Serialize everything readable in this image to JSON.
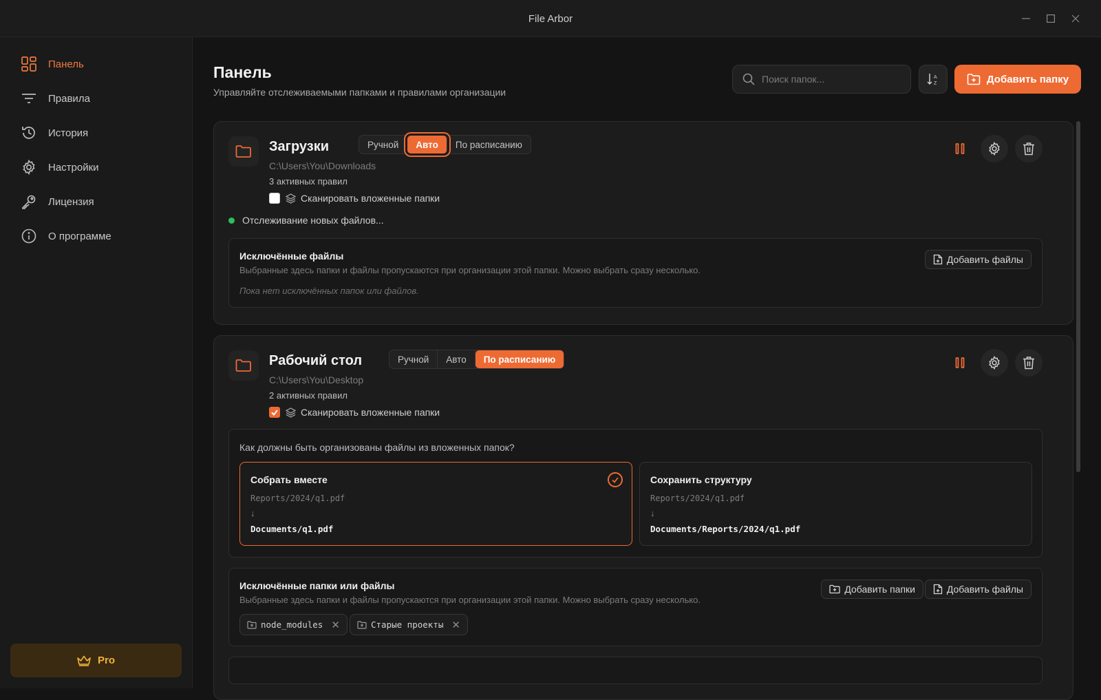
{
  "app": {
    "title": "File Arbor"
  },
  "window_controls": {
    "minimize_icon": "minimize-icon",
    "maximize_icon": "maximize-icon",
    "close_icon": "close-icon"
  },
  "sidebar": {
    "items": [
      {
        "label": "Панель",
        "icon": "dashboard-grid-icon",
        "active": true
      },
      {
        "label": "Правила",
        "icon": "filter-lines-icon",
        "active": false
      },
      {
        "label": "История",
        "icon": "history-icon",
        "active": false
      },
      {
        "label": "Настройки",
        "icon": "gear-icon",
        "active": false
      },
      {
        "label": "Лицензия",
        "icon": "key-icon",
        "active": false
      },
      {
        "label": "О программе",
        "icon": "info-icon",
        "active": false
      }
    ],
    "pro_label": "Pro"
  },
  "header": {
    "title": "Панель",
    "subtitle": "Управляйте отслеживаемыми папками и правилами организации",
    "search_placeholder": "Поиск папок...",
    "add_folder_label": "Добавить папку"
  },
  "colors": {
    "accent": "#ee6a33",
    "status_active": "#2dbd5b",
    "pro": "#f2b33a"
  },
  "folders": [
    {
      "name": "Загрузки",
      "path": "C:\\Users\\You\\Downloads",
      "rules": "3 активных правил",
      "modes": [
        "Ручной",
        "Авто",
        "По расписанию"
      ],
      "selected_mode": "Авто",
      "scan_label": "Сканировать вложенные папки",
      "scan_checked": false,
      "status": "Отслеживание новых файлов...",
      "excluded": {
        "title": "Исключённые файлы",
        "desc": "Выбранные здесь папки и файлы пропускаются при организации этой папки. Можно выбрать сразу несколько.",
        "empty": "Пока нет исключённых папок или файлов.",
        "add_files_label": "Добавить файлы"
      }
    },
    {
      "name": "Рабочий стол",
      "path": "C:\\Users\\You\\Desktop",
      "rules": "2 активных правил",
      "modes": [
        "Ручной",
        "Авто",
        "По расписанию"
      ],
      "selected_mode": "По расписанию",
      "scan_label": "Сканировать вложенные папки",
      "scan_checked": true,
      "organize": {
        "question": "Как должны быть организованы файлы из вложенных папок?",
        "options": [
          {
            "title": "Собрать вместе",
            "from": "Reports/2024/q1.pdf",
            "arrow": "↓",
            "to": "Documents/q1.pdf",
            "selected": true
          },
          {
            "title": "Сохранить структуру",
            "from": "Reports/2024/q1.pdf",
            "arrow": "↓",
            "to": "Documents/Reports/2024/q1.pdf",
            "selected": false
          }
        ]
      },
      "excluded": {
        "title": "Исключённые папки или файлы",
        "desc": "Выбранные здесь папки и файлы пропускаются при организации этой папки. Можно выбрать сразу несколько.",
        "add_folders_label": "Добавить папки",
        "add_files_label": "Добавить файлы",
        "chips": [
          "node_modules",
          "Старые проекты"
        ]
      }
    }
  ]
}
